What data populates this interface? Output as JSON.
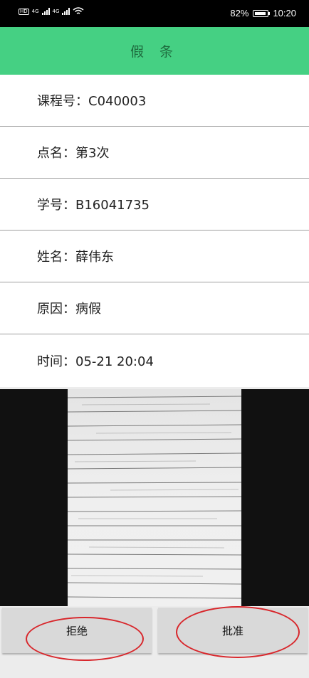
{
  "status_bar": {
    "net1": "4G",
    "net2": "4G",
    "hd1": "HD",
    "hd2": "HD",
    "battery_percent": "82%",
    "time": "10:20"
  },
  "header": {
    "title": "假 条"
  },
  "leave_note": {
    "course_no": "课程号：C040003",
    "roll_call": "点名：第3次",
    "student_id": "学号：B16041735",
    "name": "姓名：薛伟东",
    "reason": "原因：病假",
    "time": "时间：05-21 20:04"
  },
  "actions": {
    "reject_label": "拒绝",
    "approve_label": "批准",
    "highlight_color": "#d8262b"
  },
  "theme": {
    "accent": "#45d083"
  }
}
